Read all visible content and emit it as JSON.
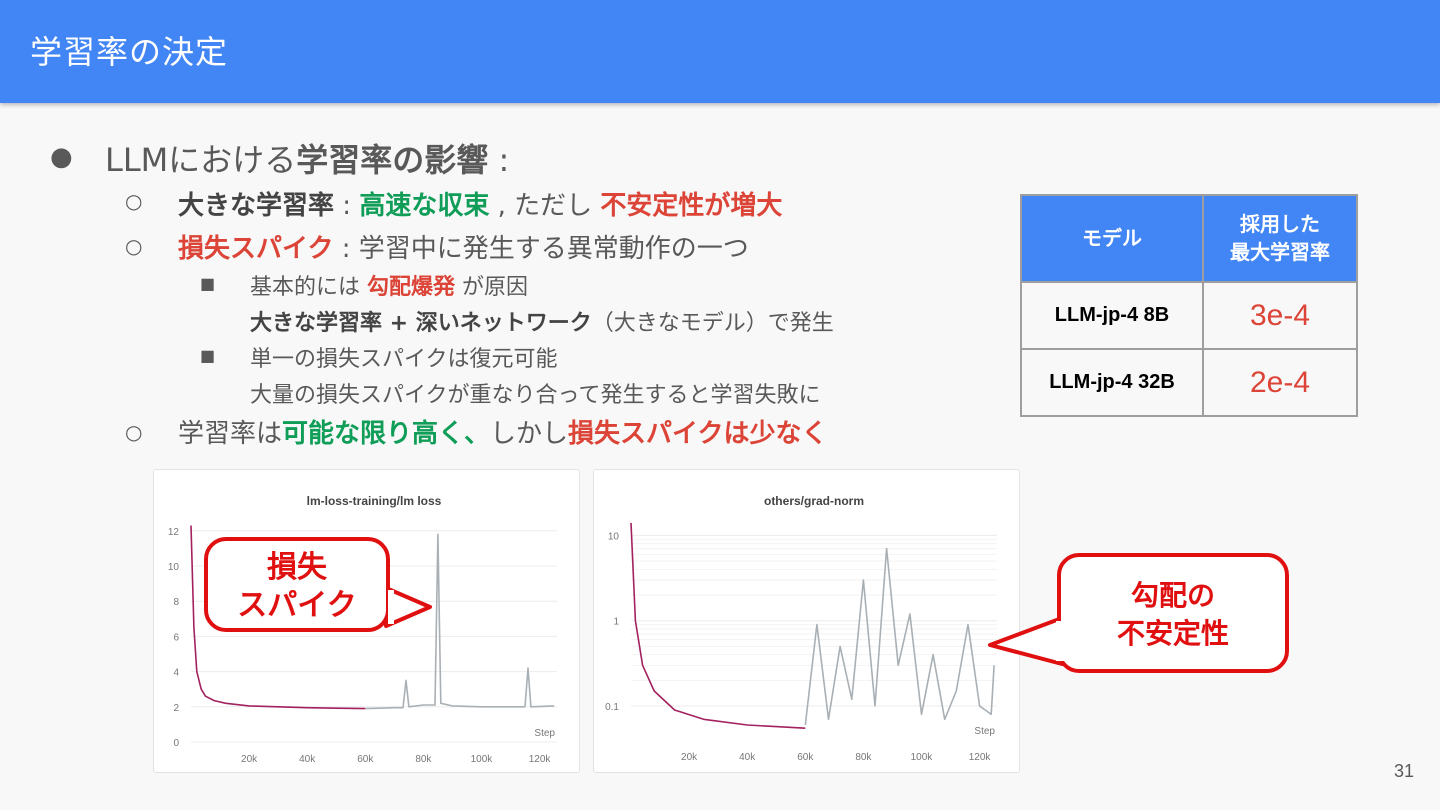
{
  "slide": {
    "title": "学習率の決定",
    "page_number": "31"
  },
  "bullets": {
    "b1": {
      "prefix": "LLMにおける",
      "emph": "学習率の影響",
      "suffix": " :"
    },
    "b1a": {
      "emph": "大きな学習率",
      "sep": " : ",
      "green": "高速な収束",
      "mid": " , ただし ",
      "red": "不安定性が増大"
    },
    "b1b": {
      "red": "損失スパイク",
      "rest": " : 学習中に発生する異常動作の一つ"
    },
    "b1b1": {
      "pre": "基本的には ",
      "red": "勾配爆発",
      "post": " が原因"
    },
    "b1b1_cont": {
      "emph": "大きな学習率 + 深いネットワーク",
      "post": "（大きなモデル）で発生"
    },
    "b1b2": {
      "text": "単一の損失スパイクは復元可能"
    },
    "b1b2_cont": {
      "text": "大量の損失スパイクが重なり合って発生すると学習失敗に"
    },
    "b1c": {
      "pre": "学習率は",
      "green": "可能な限り高く、",
      "mid": "しかし",
      "red": "損失スパイクは少なく"
    }
  },
  "lr_table": {
    "headers": [
      "モデル",
      "採用した\n最大学習率"
    ],
    "rows": [
      {
        "model": "LLM-jp-4 8B",
        "lr": "3e-4"
      },
      {
        "model": "LLM-jp-4 32B",
        "lr": "2e-4"
      }
    ]
  },
  "callouts": {
    "loss": "損失\nスパイク",
    "grad": "勾配の\n不安定性"
  },
  "colors": {
    "header": "#4285f4",
    "green": "#0f9d58",
    "red": "#db4437",
    "trained": "#a3215f",
    "later": "#a9b0b5",
    "callout": "#e01010"
  },
  "chart_data": [
    {
      "type": "line",
      "title": "lm-loss-training/lm loss",
      "xlabel": "Step",
      "x_ticks": [
        "20k",
        "40k",
        "60k",
        "80k",
        "100k",
        "120k"
      ],
      "y_ticks": [
        "0",
        "2",
        "4",
        "6",
        "8",
        "10",
        "12"
      ],
      "xlim": [
        0,
        126000
      ],
      "ylim": [
        0,
        12.5
      ],
      "series": [
        {
          "x": [
            0,
            1000,
            2000,
            3500,
            5000,
            8000,
            12000,
            20000,
            30000,
            40000,
            50000,
            60000
          ],
          "y": [
            12.3,
            6.5,
            4.0,
            3.0,
            2.6,
            2.35,
            2.2,
            2.05,
            2.0,
            1.95,
            1.92,
            1.9
          ]
        },
        {
          "x": [
            60000,
            65000,
            70000,
            73000,
            74000,
            75000,
            80000,
            84000,
            85000,
            86000,
            90000,
            100000,
            110000,
            115000,
            116000,
            117000,
            125000
          ],
          "y": [
            1.9,
            1.92,
            1.95,
            1.95,
            3.5,
            2.0,
            2.1,
            2.1,
            11.8,
            2.2,
            2.05,
            2.0,
            2.0,
            2.0,
            4.2,
            2.0,
            2.05
          ]
        }
      ]
    },
    {
      "type": "line",
      "title": "others/grad-norm",
      "xlabel": "Step",
      "y_scale": "log",
      "x_ticks": [
        "20k",
        "40k",
        "60k",
        "80k",
        "100k",
        "120k"
      ],
      "y_ticks": [
        "0.1",
        "1",
        "10"
      ],
      "xlim": [
        0,
        126000
      ],
      "ylim": [
        0.04,
        16
      ],
      "series": [
        {
          "x": [
            0,
            1500,
            4000,
            8000,
            15000,
            25000,
            40000,
            60000
          ],
          "y": [
            14,
            1.0,
            0.3,
            0.15,
            0.09,
            0.07,
            0.06,
            0.055
          ]
        },
        {
          "x": [
            60000,
            64000,
            68000,
            72000,
            76000,
            80000,
            84000,
            88000,
            92000,
            96000,
            100000,
            104000,
            108000,
            112000,
            116000,
            120000,
            124000,
            125000
          ],
          "y": [
            0.06,
            0.9,
            0.07,
            0.5,
            0.12,
            3.0,
            0.1,
            7.0,
            0.3,
            1.2,
            0.08,
            0.4,
            0.07,
            0.15,
            0.9,
            0.1,
            0.08,
            0.3
          ]
        }
      ]
    }
  ]
}
